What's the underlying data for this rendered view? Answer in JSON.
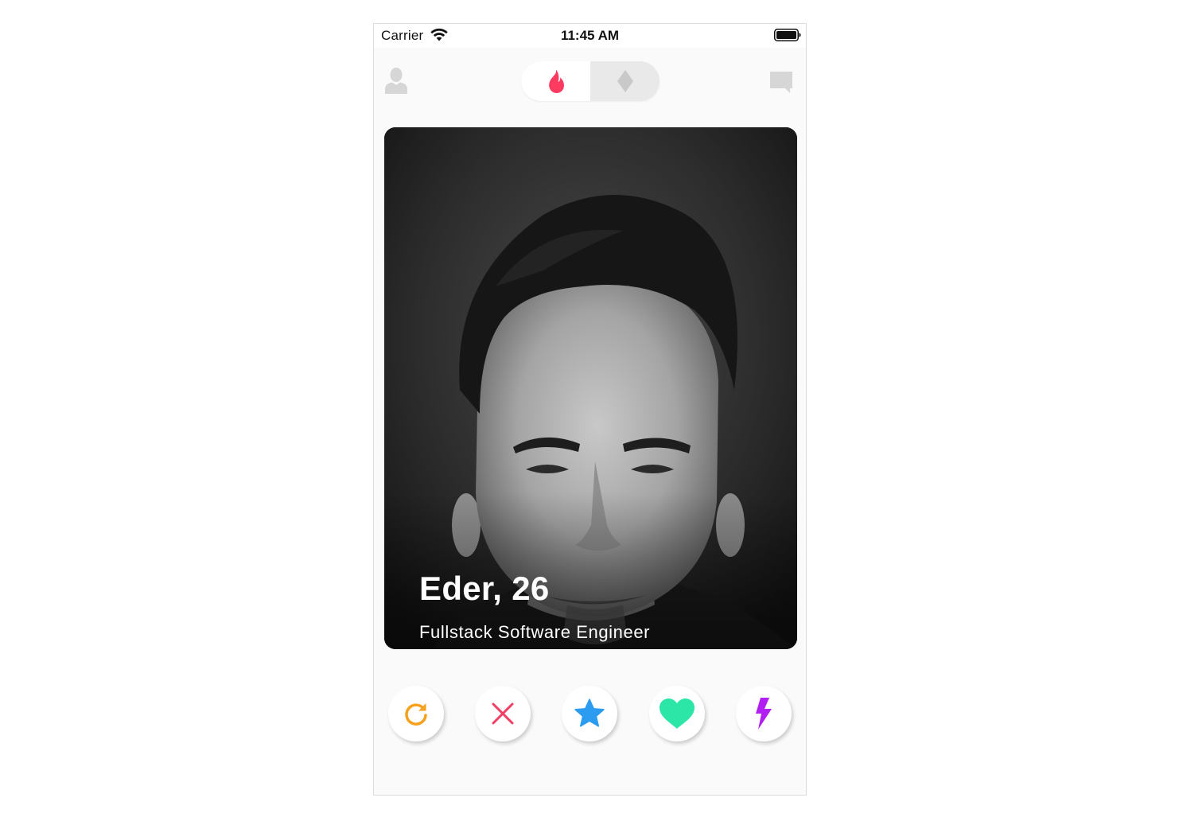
{
  "status_bar": {
    "carrier": "Carrier",
    "time": "11:45 AM"
  },
  "nav": {
    "left_icon": "profile-icon",
    "right_icon": "messages-icon",
    "segments": [
      {
        "icon": "flame-icon",
        "selected": true,
        "color": "#fd3a5f"
      },
      {
        "icon": "diamond-icon",
        "selected": false,
        "color": "#c9c9c9"
      }
    ]
  },
  "card": {
    "name": "Eder, 26",
    "subtitle": "Fullstack Software Engineer",
    "photo_icon": "portrait-photo"
  },
  "actions": [
    {
      "name": "rewind-button",
      "icon": "rewind-icon",
      "color": "#f7a01c"
    },
    {
      "name": "nope-button",
      "icon": "close-icon",
      "color": "#f43e64"
    },
    {
      "name": "super-like-button",
      "icon": "star-icon",
      "color": "#2b9cf0"
    },
    {
      "name": "like-button",
      "icon": "heart-icon",
      "color": "#2be6a6"
    },
    {
      "name": "boost-button",
      "icon": "lightning-icon",
      "color": "#b21ff2"
    }
  ]
}
